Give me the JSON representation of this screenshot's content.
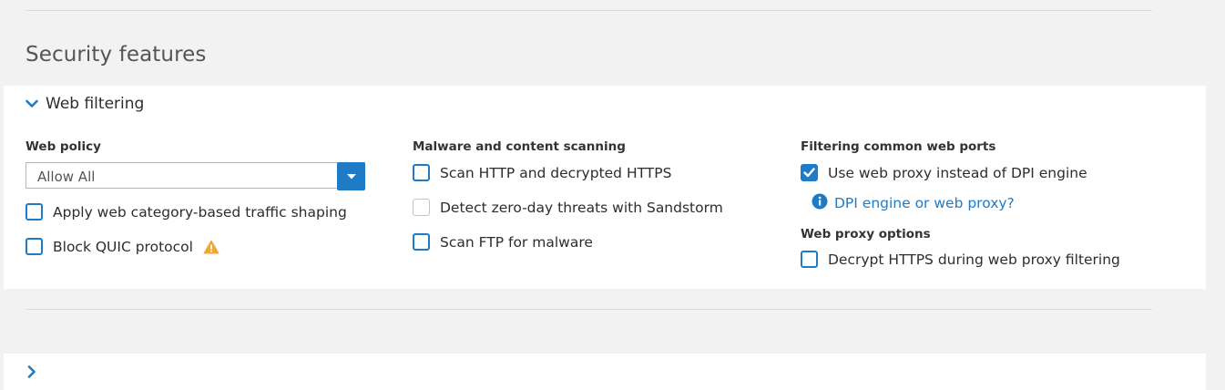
{
  "section": {
    "title": "Security features"
  },
  "web_filtering": {
    "title": "Web filtering",
    "web_policy": {
      "label": "Web policy",
      "selected": "Allow All",
      "checkboxes": [
        {
          "label": "Apply web category-based traffic shaping",
          "checked": false
        },
        {
          "label": "Block QUIC protocol",
          "checked": false,
          "icon": "warning-icon"
        }
      ]
    },
    "malware": {
      "label": "Malware and content scanning",
      "checkboxes": [
        {
          "label": "Scan HTTP and decrypted HTTPS",
          "checked": false
        },
        {
          "label": "Detect zero-day threats with Sandstorm",
          "checked": false,
          "disabled": true
        },
        {
          "label": "Scan FTP for malware",
          "checked": false
        }
      ]
    },
    "ports": {
      "label": "Filtering common web ports",
      "checkbox": {
        "label": "Use web proxy instead of DPI engine",
        "checked": true
      },
      "help_link": "DPI engine or web proxy?"
    },
    "proxy_options": {
      "label": "Web proxy options",
      "checkbox": {
        "label": "Decrypt HTTPS during web proxy filtering",
        "checked": false
      }
    }
  },
  "colors": {
    "accent": "#1f7bc6",
    "warning": "#f0a830",
    "panel_bg": "#ffffff",
    "page_bg": "#f2f2f2"
  }
}
